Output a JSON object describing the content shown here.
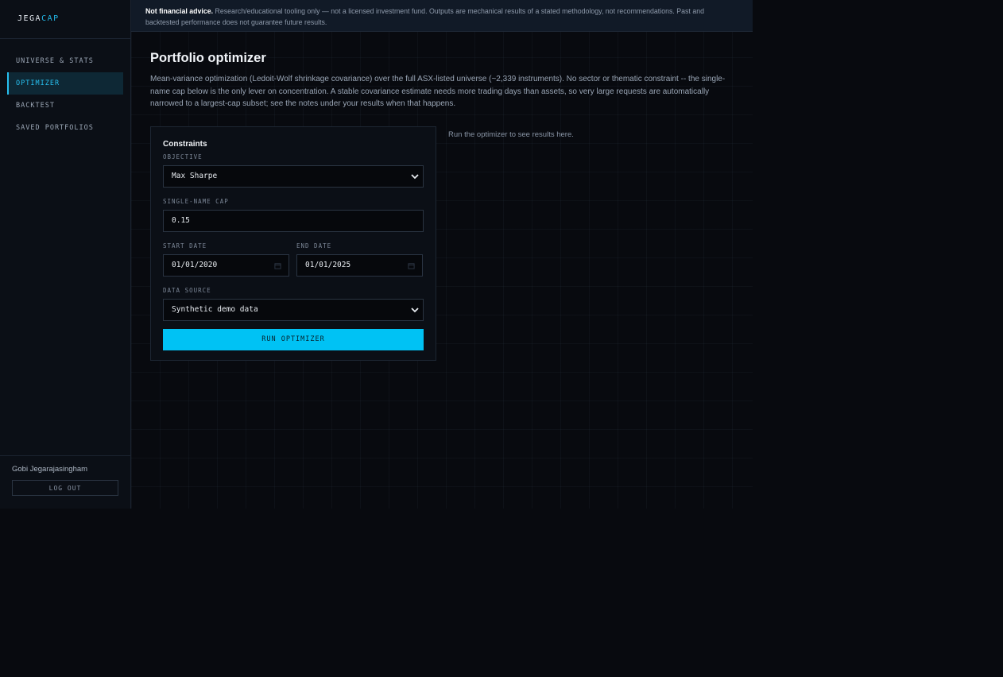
{
  "brand": {
    "part1": "JEGA",
    "part2": "CAP"
  },
  "nav": {
    "items": [
      {
        "label": "UNIVERSE & STATS"
      },
      {
        "label": "OPTIMIZER"
      },
      {
        "label": "BACKTEST"
      },
      {
        "label": "SAVED PORTFOLIOS"
      }
    ],
    "active_index": 1
  },
  "user": {
    "name": "Gobi Jegarajasingham",
    "logout_label": "LOG OUT"
  },
  "banner": {
    "bold": "Not financial advice.",
    "text": "Research/educational tooling only — not a licensed investment fund. Outputs are mechanical results of a stated methodology, not recommendations. Past and backtested performance does not guarantee future results."
  },
  "page": {
    "title": "Portfolio optimizer",
    "description": "Mean-variance optimization (Ledoit-Wolf shrinkage covariance) over the full ASX-listed universe (~2,339 instruments). No sector or thematic constraint -- the single-name cap below is the only lever on concentration. A stable covariance estimate needs more trading days than assets, so very large requests are automatically narrowed to a largest-cap subset; see the notes under your results when that happens."
  },
  "constraints": {
    "title": "Constraints",
    "objective_label": "OBJECTIVE",
    "objective_value": "Max Sharpe",
    "cap_label": "SINGLE-NAME CAP",
    "cap_value": "0.15",
    "start_label": "START DATE",
    "start_value": "01/01/2020",
    "end_label": "END DATE",
    "end_value": "01/01/2025",
    "source_label": "DATA SOURCE",
    "source_value": "Synthetic demo data",
    "run_label": "RUN OPTIMIZER"
  },
  "results": {
    "hint": "Run the optimizer to see results here."
  },
  "colors": {
    "accent": "#00c2f4",
    "background": "#080a0f",
    "sidebar": "#0b0f16"
  }
}
